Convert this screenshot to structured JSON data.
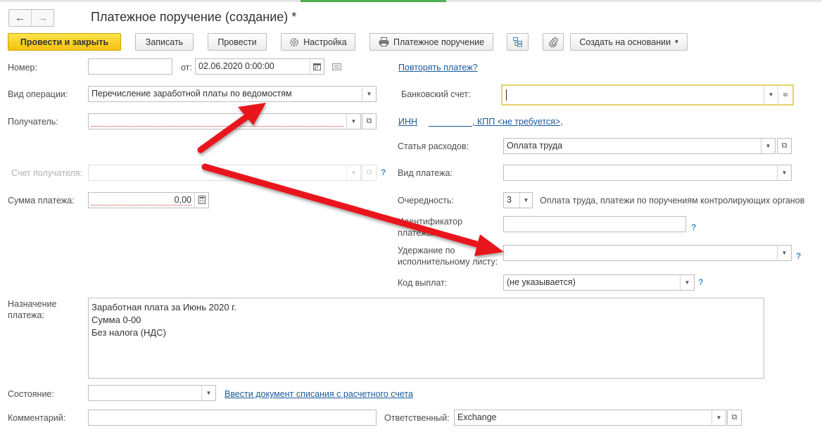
{
  "window": {
    "title": "Платежное поручение (создание) *",
    "back_icon": "←",
    "forward_icon": "→"
  },
  "toolbar": {
    "post_close": "Провести и закрыть",
    "save": "Записать",
    "post": "Провести",
    "settings": "Настройка",
    "print_order": "Платежное поручение",
    "create_based": "Создать на основании",
    "dropdown_arrow": "▾"
  },
  "form": {
    "number_label": "Номер:",
    "number_value": "",
    "date_label": "от:",
    "date_value": "02.06.2020  0:00:00",
    "repeat_link": "Повторять платеж?",
    "operation_label": "Вид операции:",
    "operation_value": "Перечисление заработной платы по ведомостям",
    "bank_account_label": "Банковский счет:",
    "bank_account_value": "",
    "recipient_label": "Получатель:",
    "recipient_value": "",
    "inn_link": "ИНН",
    "kpp_link": ", КПП <не требуется>,",
    "expense_label": "Статья расходов:",
    "expense_value": "Оплата труда",
    "recipient_account_label": "Счет получателя:",
    "payment_type_label": "Вид платежа:",
    "payment_type_value": "",
    "amount_label": "Сумма платежа:",
    "amount_value": "0,00",
    "priority_label": "Очередность:",
    "priority_value": "3",
    "priority_desc": "Оплата труда, платежи по поручениям контролирующих органов",
    "identifier_label_1": "Идентификатор",
    "identifier_label_2": "платежа:",
    "identifier_value": "",
    "withholding_label_1": "Удержание по",
    "withholding_label_2": "исполнительному листу:",
    "withholding_value": "",
    "payout_code_label": "Код выплат:",
    "payout_code_value": "(не указывается)",
    "purpose_label_1": "Назначение",
    "purpose_label_2": "платежа:",
    "purpose_lines": [
      "Заработная плата за Июнь 2020 г.",
      "Сумма 0-00",
      "Без налога (НДС)"
    ],
    "state_label": "Состояние:",
    "state_value": "",
    "writeoff_link": "Ввести документ списания с расчетного счета",
    "comment_label": "Комментарий:",
    "comment_value": "",
    "responsible_label": "Ответственный:",
    "responsible_value": "Exchange",
    "help_mark": "?"
  },
  "colors": {
    "primary_button": "#f4c20c",
    "link": "#1a5a9a",
    "arrow": "#e8161b",
    "help": "#3a8ccf"
  }
}
